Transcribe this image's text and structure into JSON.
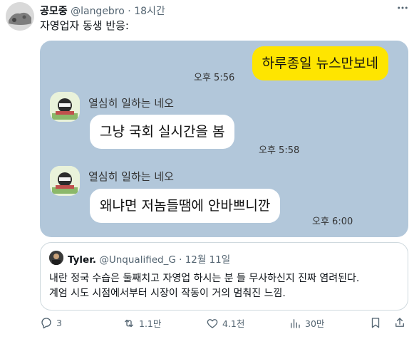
{
  "tweet": {
    "author_name": "공모중",
    "handle": "@langebro",
    "separator": "·",
    "time_ago": "18시간",
    "text": "자영업자 동생 반응:"
  },
  "chat": {
    "messages": [
      {
        "side": "right",
        "text": "하루종일 뉴스만보네",
        "time": "오후 5:56"
      },
      {
        "side": "left",
        "sender": "열심히 일하는 네오",
        "text": "그냥 국회 실시간을 봄",
        "time": "오후 5:58"
      },
      {
        "side": "left",
        "sender": "열심히 일하는 네오",
        "text": "왜냐면 저놈들땜에 안바쁘니깐",
        "time": "오후 6:00"
      }
    ]
  },
  "quote": {
    "author_name": "Tyler.",
    "handle": "@Unqualified_G",
    "separator": "·",
    "date": "12월 11일",
    "line1": "내란 정국 수습은 둘째치고 자영업 하시는 분 들 무사하신지 진짜 염려된다.",
    "line2": "계엄 시도 시점에서부터 시장이 작동이 거의 멈춰진 느낌."
  },
  "actions": {
    "reply_count": "3",
    "retweet_count": "1.1만",
    "like_count": "4.1천",
    "views_count": "30만"
  },
  "icons": [
    "more-icon",
    "reply-icon",
    "retweet-icon",
    "like-icon",
    "views-icon",
    "bookmark-icon",
    "share-icon"
  ],
  "colors": {
    "chat_background": "#b2c7da",
    "my_bubble": "#fee500",
    "their_bubble": "#ffffff",
    "secondary_text": "#536471"
  }
}
